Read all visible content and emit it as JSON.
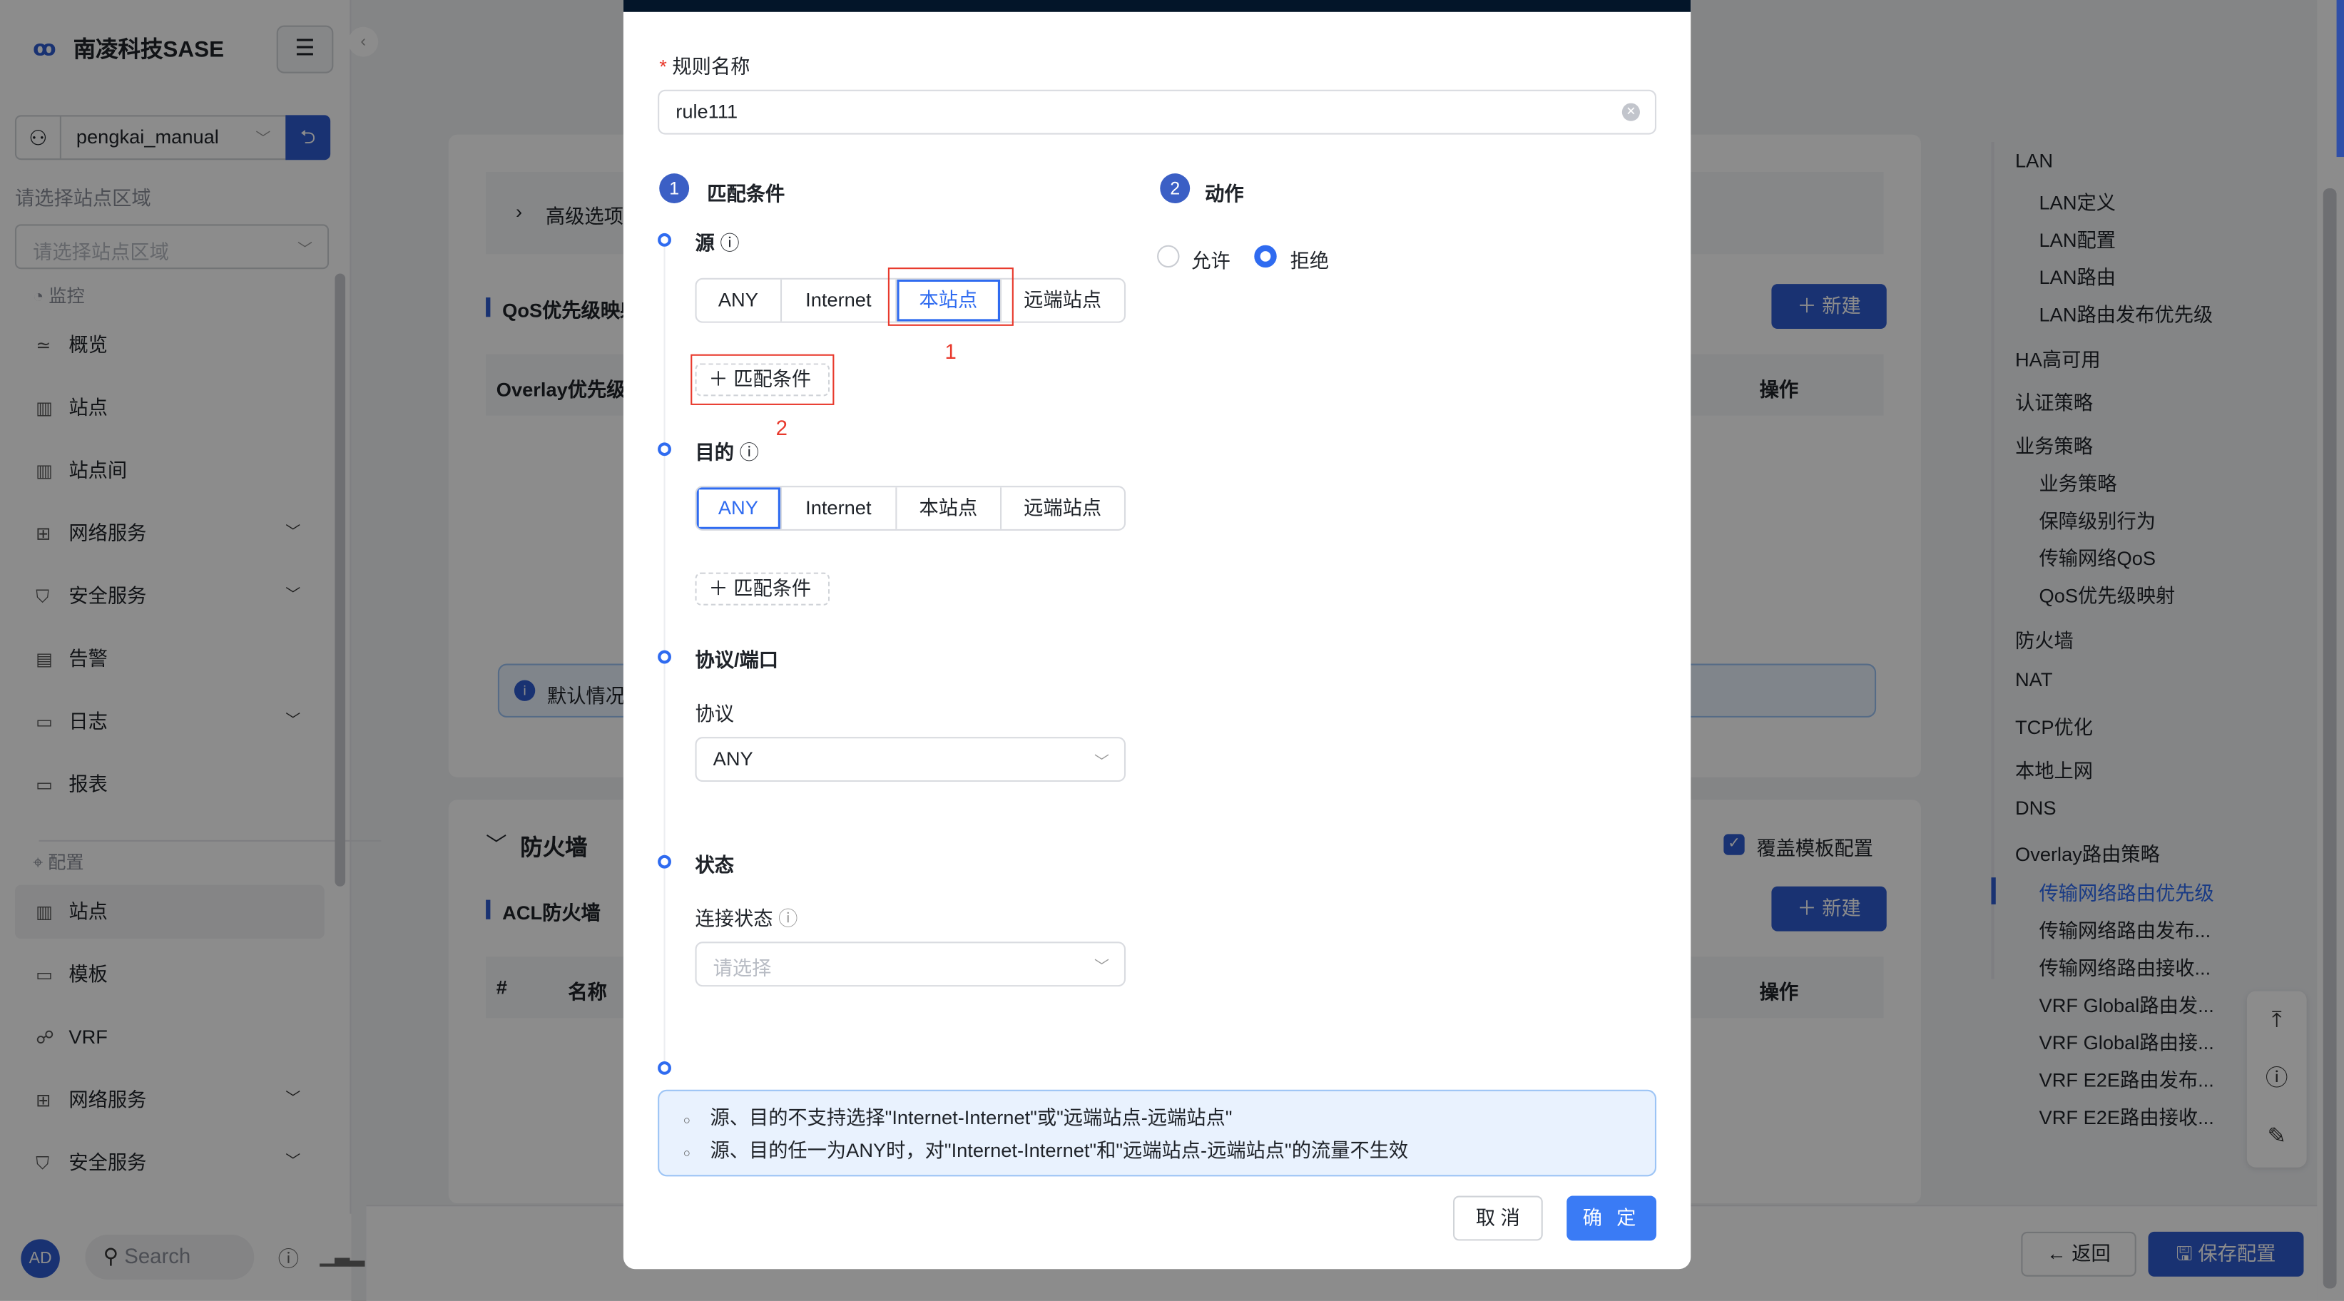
{
  "app": {
    "title": "南凌科技SASE",
    "menu_icon": "hamburger-icon",
    "collapse_icon": "chevron-left-icon"
  },
  "user": {
    "name": "pengkai_manual",
    "switch_icon": "switch-icon"
  },
  "region": {
    "label": "请选择站点区域",
    "placeholder": "请选择站点区域"
  },
  "sidebar": {
    "groups": [
      {
        "label": "监控"
      },
      {
        "label": "配置"
      }
    ],
    "monitor_items": [
      {
        "label": "概览",
        "icon": "overview-icon"
      },
      {
        "label": "站点",
        "icon": "building-icon"
      },
      {
        "label": "站点间",
        "icon": "buildings-icon"
      },
      {
        "label": "网络服务",
        "icon": "network-icon",
        "expandable": true
      },
      {
        "label": "安全服务",
        "icon": "shield-icon",
        "expandable": true
      },
      {
        "label": "告警",
        "icon": "alert-icon"
      },
      {
        "label": "日志",
        "icon": "log-icon",
        "expandable": true
      },
      {
        "label": "报表",
        "icon": "report-icon"
      }
    ],
    "config_items": [
      {
        "label": "站点",
        "icon": "building-icon",
        "selected": true
      },
      {
        "label": "模板",
        "icon": "template-icon"
      },
      {
        "label": "VRF",
        "icon": "vrf-icon"
      },
      {
        "label": "网络服务",
        "icon": "network-icon",
        "expandable": true
      },
      {
        "label": "安全服务",
        "icon": "shield-icon",
        "expandable": true
      }
    ],
    "bottom": {
      "avatar": "AD",
      "search_placeholder": "Search"
    }
  },
  "main": {
    "advanced": "高级选项",
    "qos_title": "QoS优先级映射",
    "new_label": "新建",
    "overlay_col": "Overlay优先级",
    "ops_col": "操作",
    "info_text": "默认情况",
    "firewall_title": "防火墙",
    "override_label": "覆盖模板配置",
    "override_checked": true,
    "acl_title": "ACL防火墙",
    "cols": [
      "#",
      "名称",
      "操作"
    ]
  },
  "anchor": [
    {
      "label": "LAN",
      "level": 1
    },
    {
      "label": "LAN定义",
      "level": 2
    },
    {
      "label": "LAN配置",
      "level": 2
    },
    {
      "label": "LAN路由",
      "level": 2
    },
    {
      "label": "LAN路由发布优先级",
      "level": 2
    },
    {
      "label": "HA高可用",
      "level": 1
    },
    {
      "label": "认证策略",
      "level": 1
    },
    {
      "label": "业务策略",
      "level": 1
    },
    {
      "label": "业务策略",
      "level": 2
    },
    {
      "label": "保障级别行为",
      "level": 2
    },
    {
      "label": "传输网络QoS",
      "level": 2
    },
    {
      "label": "QoS优先级映射",
      "level": 2
    },
    {
      "label": "防火墙",
      "level": 1
    },
    {
      "label": "NAT",
      "level": 1
    },
    {
      "label": "TCP优化",
      "level": 1
    },
    {
      "label": "本地上网",
      "level": 1
    },
    {
      "label": "DNS",
      "level": 1
    },
    {
      "label": "Overlay路由策略",
      "level": 1
    },
    {
      "label": "传输网络路由优先级",
      "level": 2,
      "active": true
    },
    {
      "label": "传输网络路由发布...",
      "level": 2
    },
    {
      "label": "传输网络路由接收...",
      "level": 2
    },
    {
      "label": "VRF Global路由发...",
      "level": 2
    },
    {
      "label": "VRF Global路由接...",
      "level": 2
    },
    {
      "label": "VRF E2E路由发布...",
      "level": 2
    },
    {
      "label": "VRF E2E路由接收...",
      "level": 2
    }
  ],
  "footer": {
    "back": "返回",
    "save": "保存配置"
  },
  "modal": {
    "rule_name_label": "规则名称",
    "rule_name_value": "rule111",
    "step1": {
      "num": "1",
      "title": "匹配条件"
    },
    "step2": {
      "num": "2",
      "title": "动作"
    },
    "source": {
      "label": "源",
      "options": [
        "ANY",
        "Internet",
        "本站点",
        "远端站点"
      ],
      "selected": "本站点"
    },
    "dest": {
      "label": "目的",
      "options": [
        "ANY",
        "Internet",
        "本站点",
        "远端站点"
      ],
      "selected": "ANY"
    },
    "add_condition": "匹配条件",
    "annotations": [
      "1",
      "2"
    ],
    "action": {
      "options": [
        "允许",
        "拒绝"
      ],
      "selected": "拒绝"
    },
    "protocol_section": "协议/端口",
    "protocol_label": "协议",
    "protocol_value": "ANY",
    "status_section": "状态",
    "conn_label": "连接状态",
    "conn_placeholder": "请选择",
    "notices": [
      "源、目的不支持选择\"Internet-Internet\"或\"远端站点-远端站点\"",
      "源、目的任一为ANY时，对\"Internet-Internet\"和\"远端站点-远端站点\"的流量不生效"
    ],
    "cancel": "取 消",
    "confirm": "确 定"
  },
  "colors": {
    "primary": "#2f6bf0",
    "brand": "#2f5bd0",
    "annotation": "#e8392c",
    "modal_header": "#031529"
  }
}
